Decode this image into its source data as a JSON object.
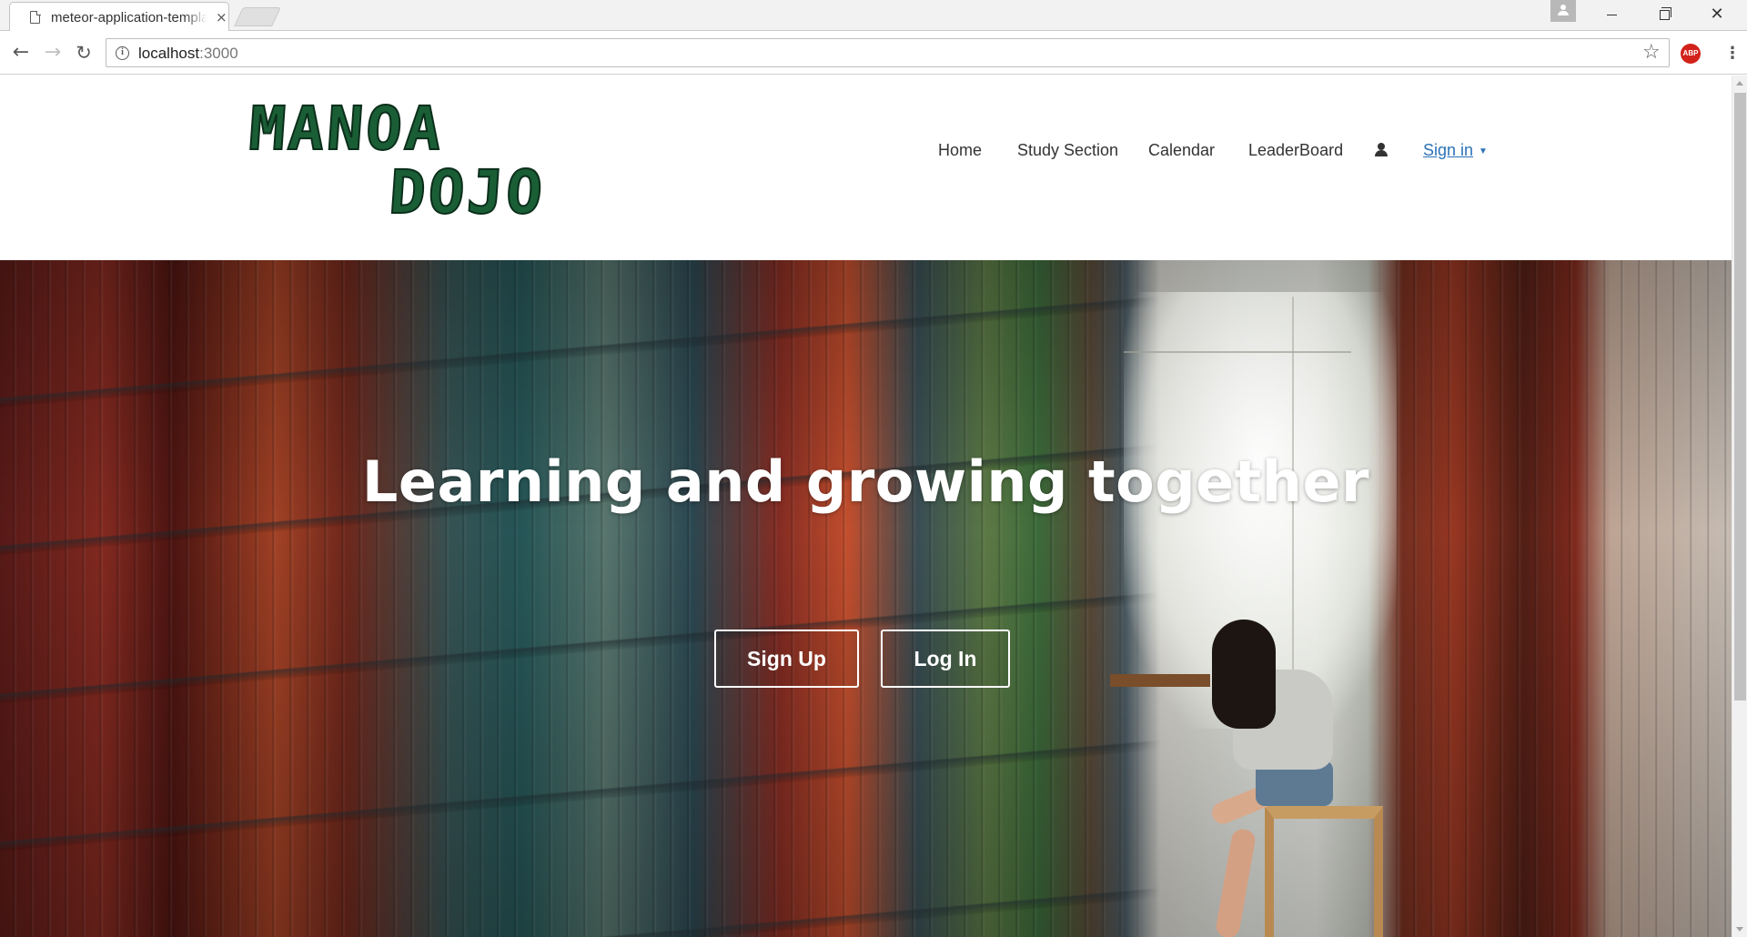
{
  "browser": {
    "tab_title": "meteor-application-template",
    "tab_close": "×",
    "url_host": "localhost",
    "url_port": ":3000",
    "abp_label": "ABP",
    "icons": [
      "file-icon",
      "back-icon",
      "forward-icon",
      "reload-icon",
      "info-icon",
      "star-icon",
      "abp-icon",
      "menu-icon",
      "profile-icon"
    ]
  },
  "header": {
    "logo_line_1": "MANOA",
    "logo_line_2": "DOJO",
    "nav": {
      "home": "Home",
      "study": "Study Section",
      "calendar": "Calendar",
      "leaderboard": "LeaderBoard",
      "signin": "Sign in",
      "signin_caret": "▼"
    }
  },
  "hero": {
    "title": "Learning and growing together",
    "signup_label": "Sign Up",
    "login_label": "Log In"
  },
  "colors": {
    "logo_green": "#1a5e36",
    "link_blue": "#2b72b8",
    "abp_red": "#d2221a"
  }
}
